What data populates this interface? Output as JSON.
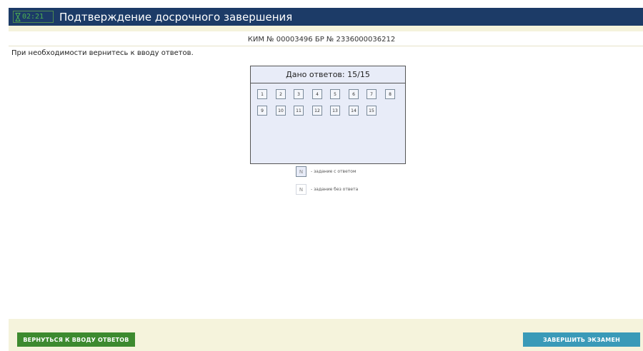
{
  "header": {
    "timer": "02:21",
    "title": "Подтверждение досрочного завершения"
  },
  "info": {
    "kim_line": "КИМ № 00003496 БР № 2336000036212",
    "instruction": "При необходимости вернитесь к вводу ответов."
  },
  "answers_panel": {
    "heading": "Дано ответов: 15/15",
    "tasks": [
      {
        "number": "1",
        "answered": true
      },
      {
        "number": "2",
        "answered": true
      },
      {
        "number": "3",
        "answered": true
      },
      {
        "number": "4",
        "answered": true
      },
      {
        "number": "5",
        "answered": true
      },
      {
        "number": "6",
        "answered": true
      },
      {
        "number": "7",
        "answered": true
      },
      {
        "number": "8",
        "answered": true
      },
      {
        "number": "9",
        "answered": true
      },
      {
        "number": "10",
        "answered": true
      },
      {
        "number": "11",
        "answered": true
      },
      {
        "number": "12",
        "answered": true
      },
      {
        "number": "13",
        "answered": true
      },
      {
        "number": "14",
        "answered": true
      },
      {
        "number": "15",
        "answered": true
      }
    ]
  },
  "legend": {
    "answered_symbol": "N",
    "answered_label": "- задание с ответом",
    "unanswered_symbol": "N",
    "unanswered_label": "- задание без ответа"
  },
  "buttons": {
    "back": "ВЕРНУТЬСЯ К ВВОДУ ОТВЕТОВ",
    "finish": "ЗАВЕРШИТЬ ЭКЗАМЕН"
  },
  "colors": {
    "header_bg": "#1c3b67",
    "timer": "#4caf50",
    "back_button": "#3d8a2f",
    "finish_button": "#3a9ab8",
    "panel_bg": "#e8ecf8",
    "cream": "#f5f3dc"
  }
}
